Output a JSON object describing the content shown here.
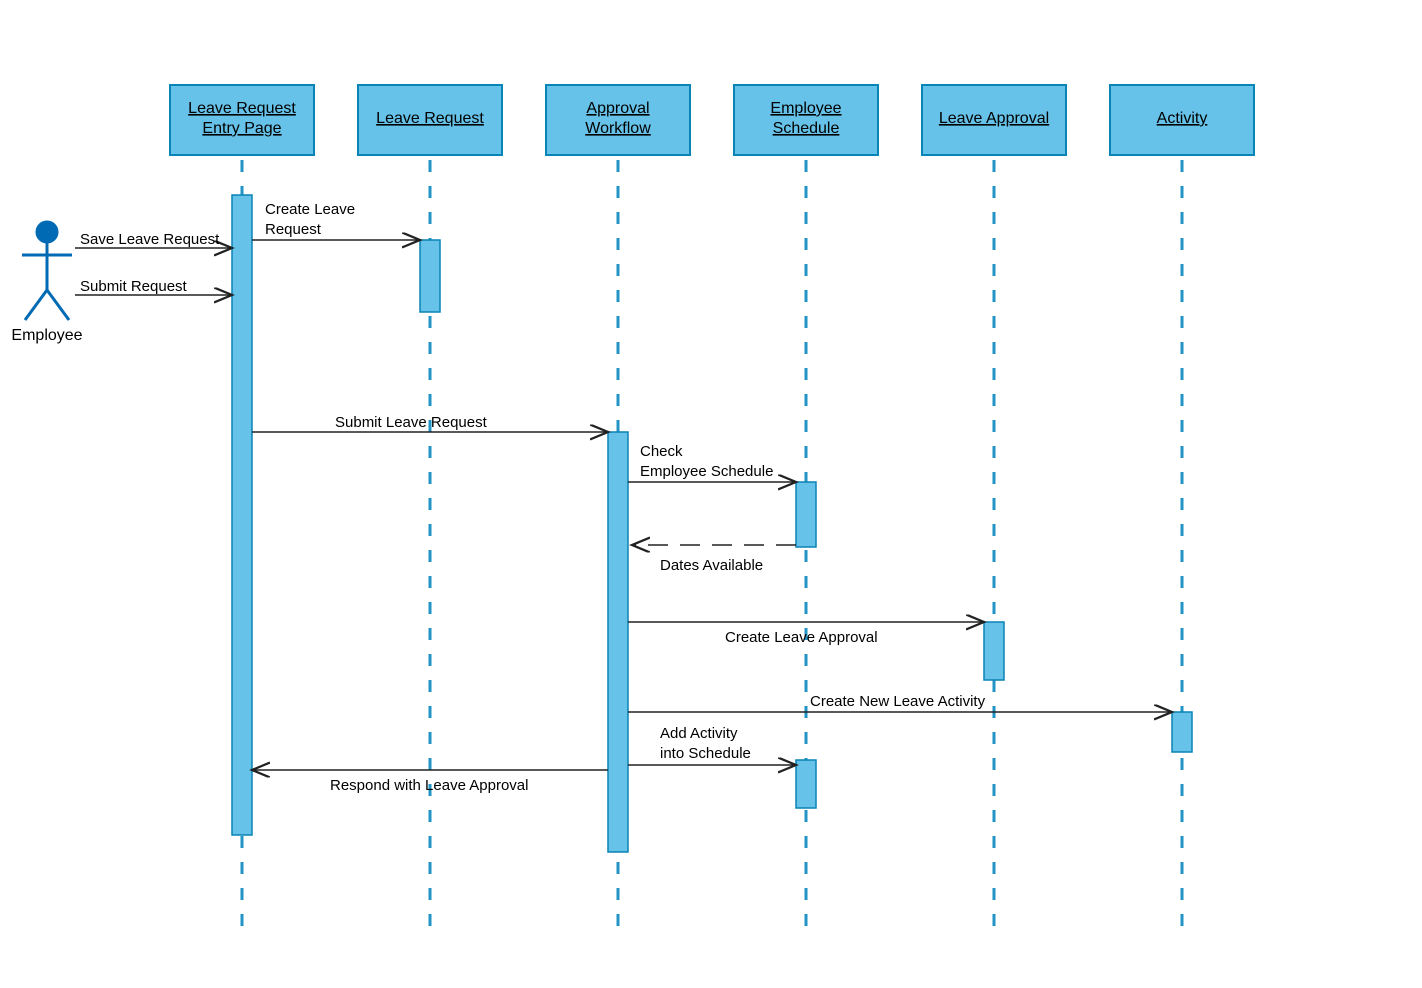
{
  "actor": {
    "label": "Employee"
  },
  "participants": [
    {
      "line1": "Leave Request",
      "line2": "Entry Page"
    },
    {
      "line1": "Leave Request",
      "line2": ""
    },
    {
      "line1": "Approval",
      "line2": "Workflow"
    },
    {
      "line1": "Employee",
      "line2": "Schedule"
    },
    {
      "line1": "Leave Approval",
      "line2": ""
    },
    {
      "line1": "Activity",
      "line2": ""
    }
  ],
  "messages": {
    "save_leave_request": "Save Leave Request",
    "submit_request": "Submit  Request",
    "create_leave_request_1": "Create Leave",
    "create_leave_request_2": "Request",
    "submit_leave_request": "Submit  Leave Request",
    "check_emp_sched_1": "Check",
    "check_emp_sched_2": "Employee Schedule",
    "dates_available": "Dates Available",
    "create_leave_approval": "Create Leave Approval",
    "create_new_leave_activity": "Create New Leave Activity",
    "add_activity_1": "Add Activity",
    "add_activity_2": "into Schedule",
    "respond_leave_approval": "Respond with Leave Approval"
  },
  "colors": {
    "participant_fill": "#66c2e8",
    "participant_stroke": "#0a83b5",
    "lifeline": "#2294c5",
    "actor": "#006ab4"
  }
}
